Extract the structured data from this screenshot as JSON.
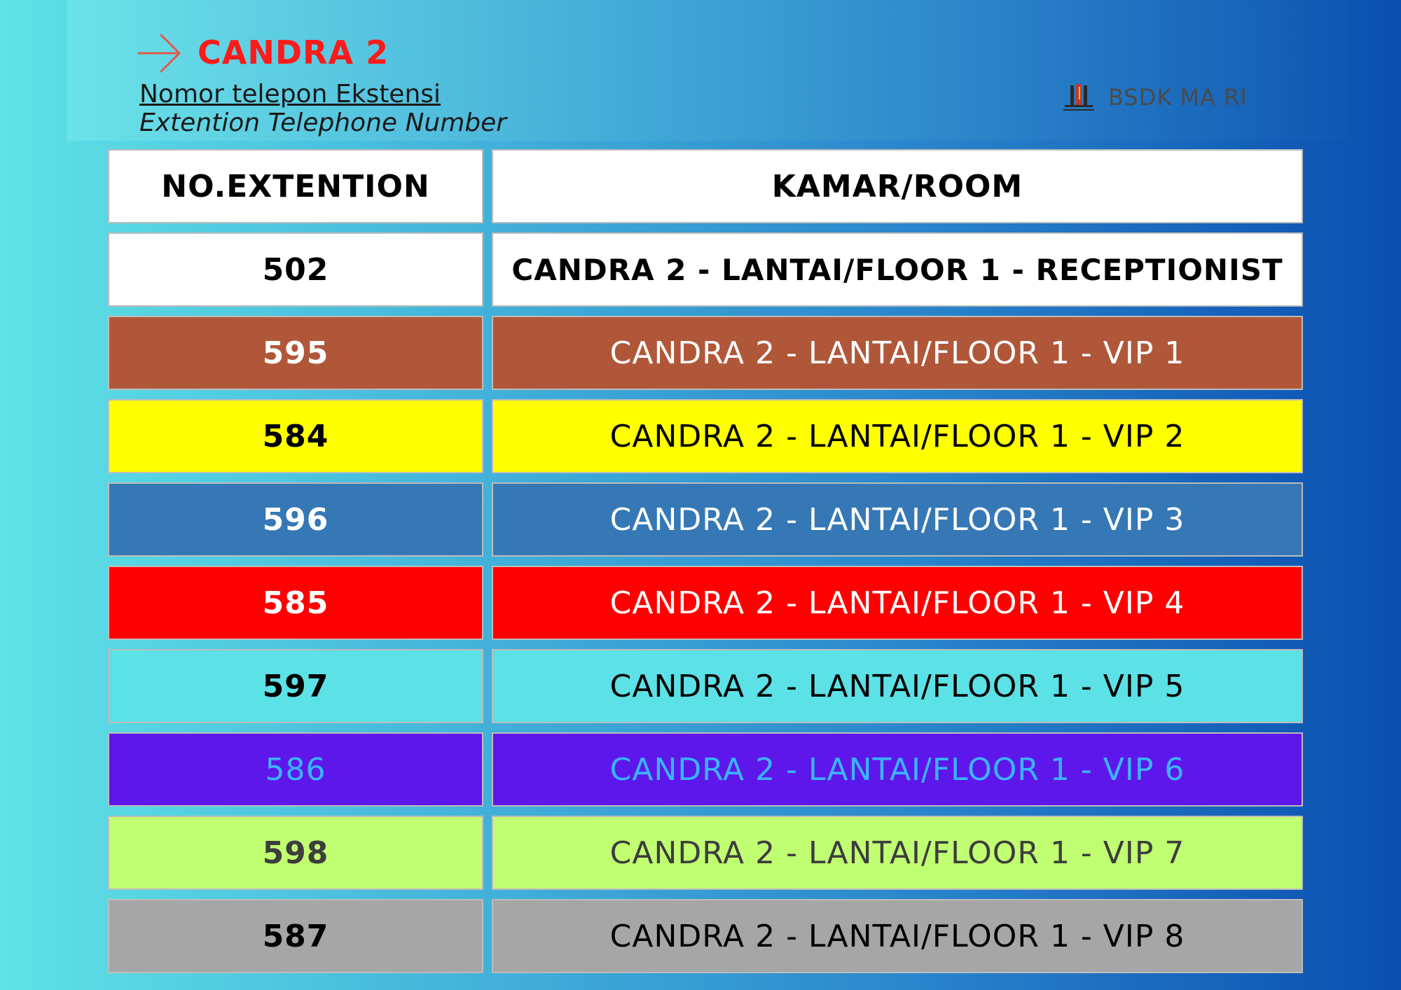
{
  "header": {
    "title": "CANDRA 2",
    "subtitle": "Nomor telepon Ekstensi",
    "subtitle_en": "Extention Telephone Number",
    "logo_text": "BSDK MA RI",
    "arrow_icon": "arrow-right-icon",
    "logo_icon": "supreme-court-logo-icon"
  },
  "colors": {
    "title": "#ff1a1a",
    "header_row": "#ffffff",
    "receptionist": "#ffffff",
    "vip1": "#b0573a",
    "vip2": "#ffff00",
    "vip3": "#3578b5",
    "vip4": "#ff0000",
    "vip5": "#5ce1e6",
    "vip6": "#5e17eb",
    "vip7": "#c1ff72",
    "vip8": "#a6a6a6"
  },
  "table": {
    "headers": {
      "extension": "NO.EXTENTION",
      "room": "KAMAR/ROOM"
    },
    "rows": [
      {
        "ext": "502",
        "room": "CANDRA 2 - LANTAI/FLOOR 1 - RECEPTIONIST",
        "bg": "#ffffff",
        "fg": "#000000",
        "bold_room": true
      },
      {
        "ext": "595",
        "room": "CANDRA 2 - LANTAI/FLOOR 1 - VIP 1",
        "bg": "#b0573a",
        "fg": "#ffffff",
        "bold_room": false
      },
      {
        "ext": "584",
        "room": "CANDRA 2 - LANTAI/FLOOR 1 - VIP 2",
        "bg": "#ffff00",
        "fg": "#000000",
        "bold_room": false
      },
      {
        "ext": "596",
        "room": "CANDRA 2 - LANTAI/FLOOR 1 - VIP 3",
        "bg": "#3578b5",
        "fg": "#ffffff",
        "bold_room": false
      },
      {
        "ext": "585",
        "room": "CANDRA 2 - LANTAI/FLOOR 1 - VIP 4",
        "bg": "#ff0000",
        "fg": "#ffffff",
        "bold_room": false
      },
      {
        "ext": "597",
        "room": "CANDRA 2 - LANTAI/FLOOR 1 - VIP 5",
        "bg": "#5ce1e6",
        "fg": "#000000",
        "bold_room": false
      },
      {
        "ext": "586",
        "room": "CANDRA 2 - LANTAI/FLOOR 1 - VIP 6",
        "bg": "#5e17eb",
        "fg": "#38b6ff",
        "bold_room": false,
        "bold_ext": false
      },
      {
        "ext": "598",
        "room": "CANDRA 2 - LANTAI/FLOOR 1 - VIP 7",
        "bg": "#c1ff72",
        "fg": "#3d3d3d",
        "bold_room": false
      },
      {
        "ext": "587",
        "room": "CANDRA 2 - LANTAI/FLOOR 1 - VIP 8",
        "bg": "#a6a6a6",
        "fg": "#000000",
        "bold_room": false
      }
    ]
  }
}
